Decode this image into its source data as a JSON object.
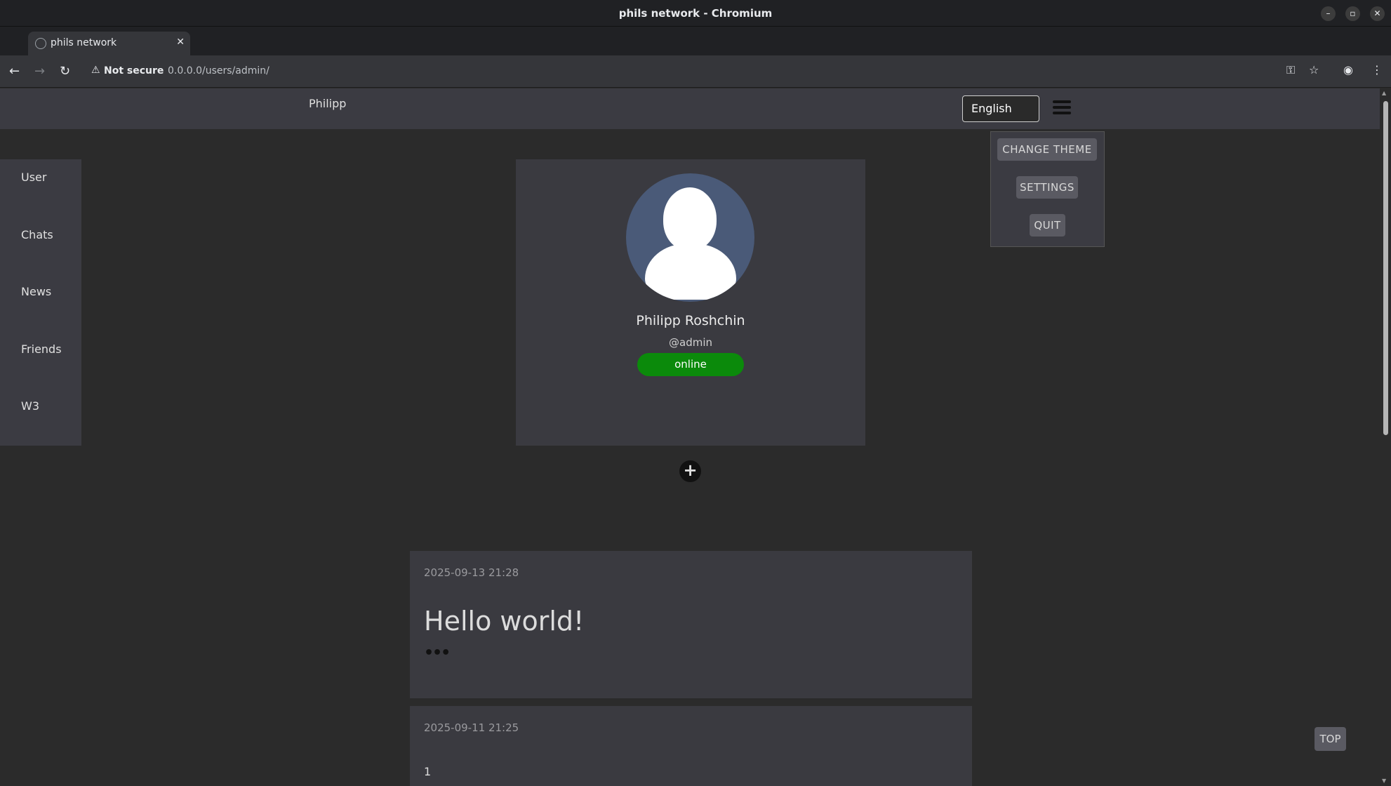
{
  "window": {
    "title": "phils network - Chromium"
  },
  "tab": {
    "title": "phils network"
  },
  "address": {
    "security": "Not secure",
    "url": "0.0.0.0/users/admin/"
  },
  "header": {
    "brand": "Philipp",
    "language": "English"
  },
  "menu": {
    "change_theme": "CHANGE THEME",
    "settings": "SETTINGS",
    "quit": "QUIT"
  },
  "sidebar": {
    "items": [
      {
        "label": "User"
      },
      {
        "label": "Chats"
      },
      {
        "label": "News"
      },
      {
        "label": "Friends"
      },
      {
        "label": "W3"
      }
    ]
  },
  "profile": {
    "name": "Philipp Roshchin",
    "handle": "@admin",
    "status": "online",
    "status_color": "#0b8a0b"
  },
  "posts": [
    {
      "date": "2025-09-13 21:28",
      "title": "Hello world!",
      "more": "•••"
    },
    {
      "date": "2025-09-11 21:25",
      "body": "1"
    }
  ],
  "top_button": "TOP",
  "icons": {
    "add_post": "plus-circle-icon",
    "menu": "hamburger-icon"
  }
}
